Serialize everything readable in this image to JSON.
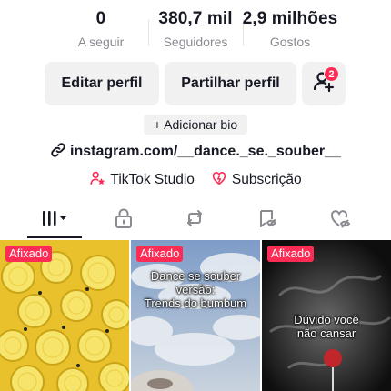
{
  "stats": {
    "following": {
      "value": "0",
      "label": "A seguir"
    },
    "followers": {
      "value": "380,7 mil",
      "label": "Seguidores"
    },
    "likes": {
      "value": "2,9 milhões",
      "label": "Gostos"
    }
  },
  "buttons": {
    "edit_profile": "Editar perfil",
    "share_profile": "Partilhar perfil",
    "add_friends_badge": "2"
  },
  "bio": {
    "add_label": "+ Adicionar bio"
  },
  "link": {
    "text": "instagram.com/__dance._se._souber__",
    "icon": "link-icon"
  },
  "tools": [
    {
      "label": "TikTok Studio",
      "icon": "studio-person-star-icon"
    },
    {
      "label": "Subscrição",
      "icon": "subscription-heart-icon"
    }
  ],
  "tabs": [
    {
      "name": "videos",
      "icon": "grid-bars-icon"
    },
    {
      "name": "private",
      "icon": "lock-icon"
    },
    {
      "name": "reposts",
      "icon": "repost-icon"
    },
    {
      "name": "favorites",
      "icon": "bookmark-eye-icon"
    },
    {
      "name": "liked",
      "icon": "heart-hidden-icon"
    }
  ],
  "videos": [
    {
      "pinned_label": "Afixado",
      "caption": ""
    },
    {
      "pinned_label": "Afixado",
      "caption_lines": [
        "Dance se souber",
        "versão:",
        "Trends do bumbum"
      ]
    },
    {
      "pinned_label": "Afixado",
      "caption_lines": [
        "Dúvido você",
        "não cansar"
      ]
    }
  ],
  "colors": {
    "accent": "#fe2c55",
    "text": "#161823",
    "muted": "#8a8b91",
    "button_bg": "#f1f1f2"
  }
}
